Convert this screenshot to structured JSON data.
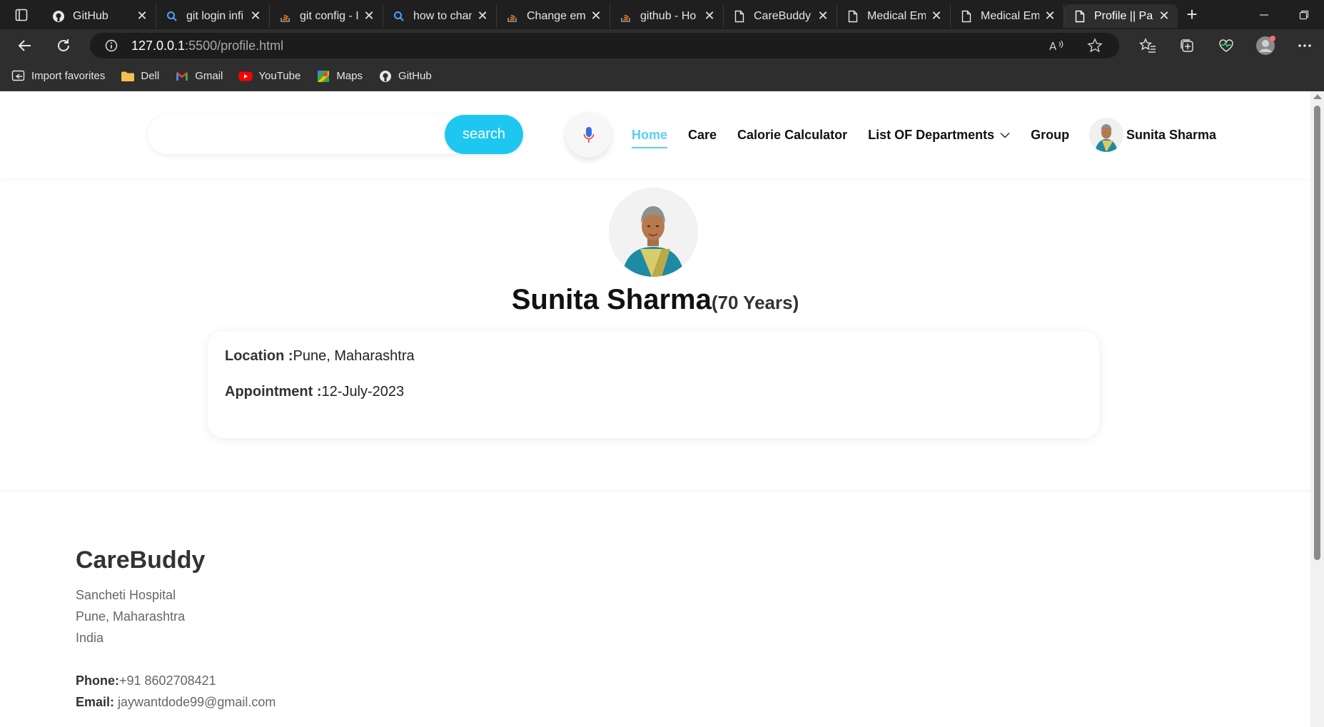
{
  "browser": {
    "tabs": [
      {
        "title": "GitHub",
        "icon": "github-icon",
        "active": false
      },
      {
        "title": "git login infi",
        "icon": "search-icon",
        "active": false
      },
      {
        "title": "git config - I",
        "icon": "stackoverflow-icon",
        "active": false
      },
      {
        "title": "how to chan",
        "icon": "search-icon",
        "active": false
      },
      {
        "title": "Change em",
        "icon": "stackoverflow-icon",
        "active": false
      },
      {
        "title": "github - Ho",
        "icon": "stackoverflow-icon",
        "active": false
      },
      {
        "title": "CareBuddy",
        "icon": "page-icon",
        "active": false
      },
      {
        "title": "Medical Em",
        "icon": "page-icon",
        "active": false
      },
      {
        "title": "Medical Em",
        "icon": "page-icon",
        "active": false
      },
      {
        "title": "Profile || Pa",
        "icon": "page-icon",
        "active": true
      }
    ],
    "address": {
      "host": "127.0.0.1",
      "rest": ":5500/profile.html"
    },
    "bookmarks": [
      {
        "label": "Import favorites",
        "icon": "import-icon"
      },
      {
        "label": "Dell",
        "icon": "folder-icon"
      },
      {
        "label": "Gmail",
        "icon": "gmail-icon"
      },
      {
        "label": "YouTube",
        "icon": "youtube-icon"
      },
      {
        "label": "Maps",
        "icon": "maps-icon"
      },
      {
        "label": "GitHub",
        "icon": "github-icon"
      }
    ]
  },
  "header": {
    "search_placeholder": "",
    "search_button": "search",
    "nav": [
      "Home",
      "Care",
      "Calorie Calculator",
      "List OF Departments",
      "Group"
    ],
    "active_nav": "Home",
    "user_name": "Sunita Sharma"
  },
  "profile": {
    "name": "Sunita Sharma",
    "age": "(70 Years)",
    "location_label": "Location :",
    "location_value": "Pune, Maharashtra",
    "appointment_label": "Appointment :",
    "appointment_value": "12-July-2023"
  },
  "footer": {
    "brand": "CareBuddy",
    "address_lines": [
      "Sancheti Hospital",
      "Pune, Maharashtra",
      "India"
    ],
    "phone_label": "Phone:",
    "phone_value": "+91 8602708421",
    "email_label": "Email:",
    "email_value": " jaywantdode99@gmail.com"
  },
  "colors": {
    "accent": "#1ec7f0",
    "nav_active": "#5ad0ee",
    "chrome_dark": "#1f1f1f",
    "chrome_toolbar": "#2e2e2e"
  }
}
